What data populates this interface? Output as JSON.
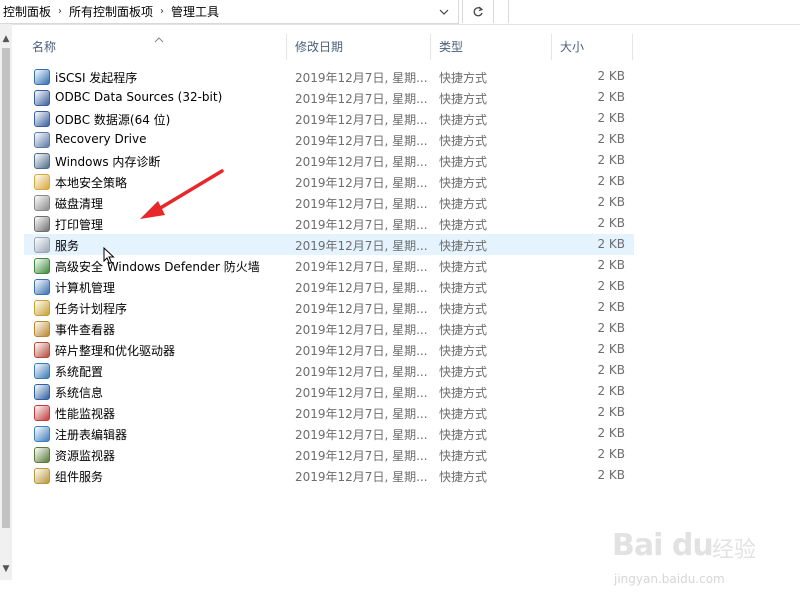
{
  "breadcrumb": {
    "items": [
      "控制面板",
      "所有控制面板项",
      "管理工具"
    ],
    "separator": "›"
  },
  "icons": {
    "dropdown": "chevron-down-icon",
    "refresh": "refresh-icon"
  },
  "columns": {
    "name": "名称",
    "date": "修改日期",
    "type": "类型",
    "size": "大小"
  },
  "files": [
    {
      "name": "iSCSI 发起程序",
      "date": "2019年12月7日, 星期...",
      "type": "快捷方式",
      "size": "2 KB",
      "icon": "iscsi-icon",
      "color": "#2f6fb3"
    },
    {
      "name": "ODBC Data Sources (32-bit)",
      "date": "2019年12月7日, 星期...",
      "type": "快捷方式",
      "size": "2 KB",
      "icon": "odbc-icon",
      "color": "#3a5f9e"
    },
    {
      "name": "ODBC 数据源(64 位)",
      "date": "2019年12月7日, 星期...",
      "type": "快捷方式",
      "size": "2 KB",
      "icon": "odbc-icon",
      "color": "#3a5f9e"
    },
    {
      "name": "Recovery Drive",
      "date": "2019年12月7日, 星期...",
      "type": "快捷方式",
      "size": "2 KB",
      "icon": "recovery-drive-icon",
      "color": "#5b7aa6"
    },
    {
      "name": "Windows 内存诊断",
      "date": "2019年12月7日, 星期...",
      "type": "快捷方式",
      "size": "2 KB",
      "icon": "memory-diagnostic-icon",
      "color": "#4f6b8e"
    },
    {
      "name": "本地安全策略",
      "date": "2019年12月7日, 星期...",
      "type": "快捷方式",
      "size": "2 KB",
      "icon": "security-policy-icon",
      "color": "#d9a73a"
    },
    {
      "name": "磁盘清理",
      "date": "2019年12月7日, 星期...",
      "type": "快捷方式",
      "size": "2 KB",
      "icon": "disk-cleanup-icon",
      "color": "#8a8a8a"
    },
    {
      "name": "打印管理",
      "date": "2019年12月7日, 星期...",
      "type": "快捷方式",
      "size": "2 KB",
      "icon": "print-management-icon",
      "color": "#6f6f6f"
    },
    {
      "name": "服务",
      "date": "2019年12月7日, 星期...",
      "type": "快捷方式",
      "size": "2 KB",
      "icon": "services-icon",
      "color": "#9aa6b4"
    },
    {
      "name": "高级安全 Windows Defender 防火墙",
      "date": "2019年12月7日, 星期...",
      "type": "快捷方式",
      "size": "2 KB",
      "icon": "firewall-icon",
      "color": "#3c8a3c"
    },
    {
      "name": "计算机管理",
      "date": "2019年12月7日, 星期...",
      "type": "快捷方式",
      "size": "2 KB",
      "icon": "computer-management-icon",
      "color": "#3a6fb0"
    },
    {
      "name": "任务计划程序",
      "date": "2019年12月7日, 星期...",
      "type": "快捷方式",
      "size": "2 KB",
      "icon": "task-scheduler-icon",
      "color": "#c8a030"
    },
    {
      "name": "事件查看器",
      "date": "2019年12月7日, 星期...",
      "type": "快捷方式",
      "size": "2 KB",
      "icon": "event-viewer-icon",
      "color": "#b8872c"
    },
    {
      "name": "碎片整理和优化驱动器",
      "date": "2019年12月7日, 星期...",
      "type": "快捷方式",
      "size": "2 KB",
      "icon": "defrag-icon",
      "color": "#b44a3a"
    },
    {
      "name": "系统配置",
      "date": "2019年12月7日, 星期...",
      "type": "快捷方式",
      "size": "2 KB",
      "icon": "system-config-icon",
      "color": "#3a78b8"
    },
    {
      "name": "系统信息",
      "date": "2019年12月7日, 星期...",
      "type": "快捷方式",
      "size": "2 KB",
      "icon": "system-info-icon",
      "color": "#2f5fa0"
    },
    {
      "name": "性能监视器",
      "date": "2019年12月7日, 星期...",
      "type": "快捷方式",
      "size": "2 KB",
      "icon": "performance-monitor-icon",
      "color": "#c23b3b"
    },
    {
      "name": "注册表编辑器",
      "date": "2019年12月7日, 星期...",
      "type": "快捷方式",
      "size": "2 KB",
      "icon": "registry-editor-icon",
      "color": "#3f7fc0"
    },
    {
      "name": "资源监视器",
      "date": "2019年12月7日, 星期...",
      "type": "快捷方式",
      "size": "2 KB",
      "icon": "resource-monitor-icon",
      "color": "#5a7a3a"
    },
    {
      "name": "组件服务",
      "date": "2019年12月7日, 星期...",
      "type": "快捷方式",
      "size": "2 KB",
      "icon": "component-services-icon",
      "color": "#b8963a"
    }
  ],
  "hovered_row": 8,
  "annotation": {
    "arrow_color": "#e8272b"
  },
  "watermark": {
    "logo": "Bai du",
    "text": "经验",
    "url": "jingyan.baidu.com"
  }
}
